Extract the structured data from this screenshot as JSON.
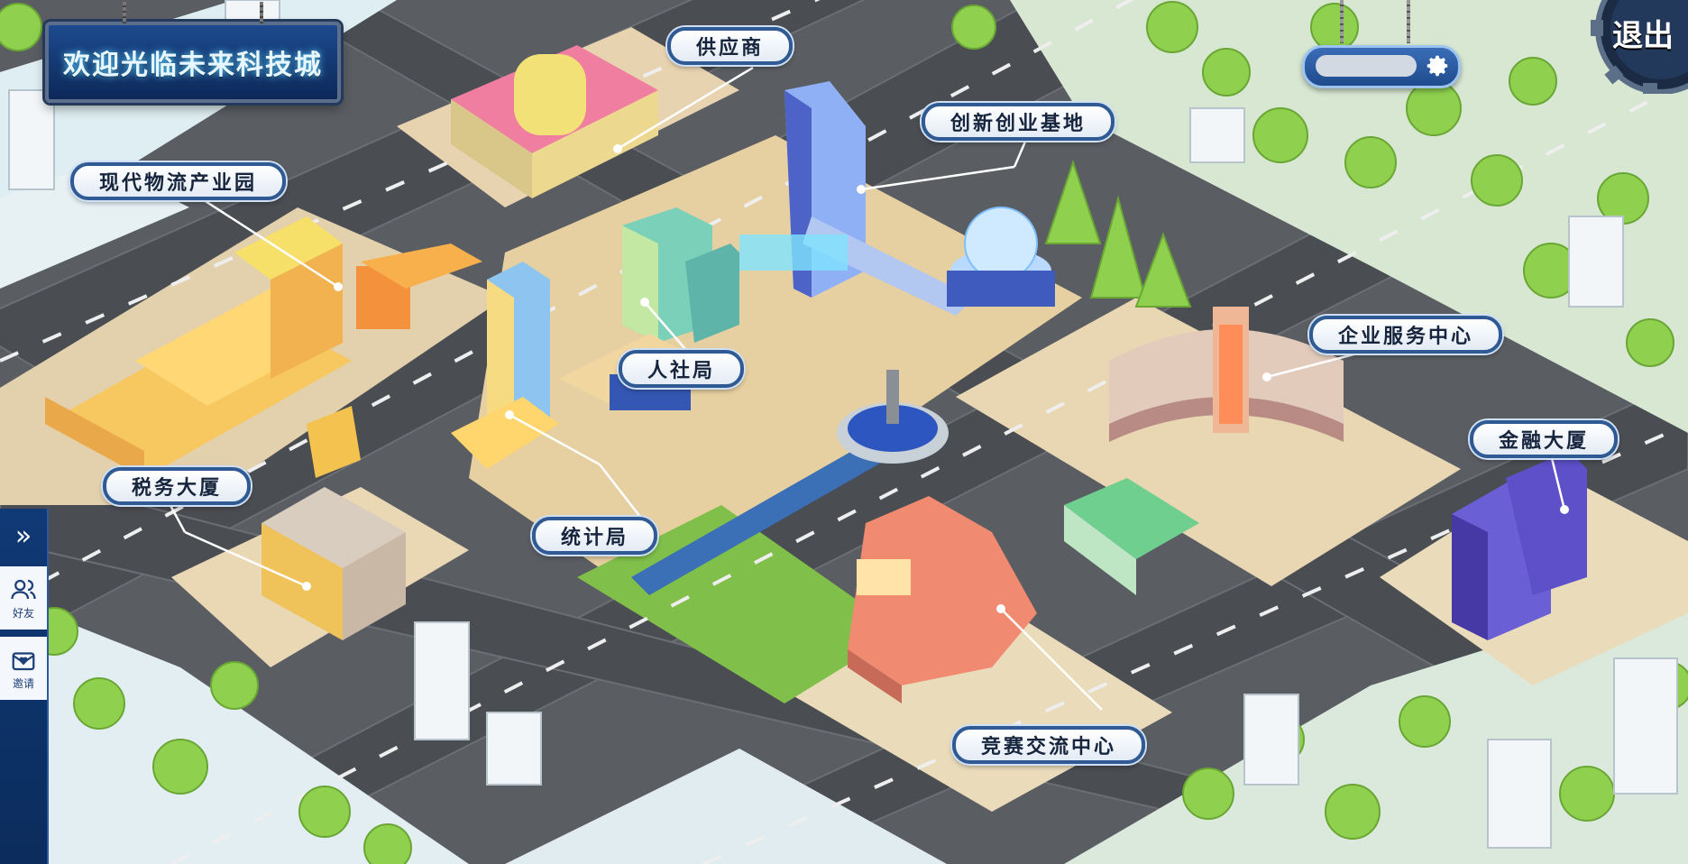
{
  "title": "欢迎光临未来科技城",
  "exit_label": "退出",
  "user": {
    "name": "",
    "settings_icon": "gear-icon"
  },
  "sidebar": {
    "expand_icon": "double-chevron-right-icon",
    "items": [
      {
        "label": "好友",
        "icon": "friends-icon"
      },
      {
        "label": "邀请",
        "icon": "invite-icon"
      }
    ]
  },
  "buildings": [
    {
      "id": "supplier",
      "label": "供应商"
    },
    {
      "id": "innovation-base",
      "label": "创新创业基地"
    },
    {
      "id": "logistics-park",
      "label": "现代物流产业园"
    },
    {
      "id": "hr-bureau",
      "label": "人社局"
    },
    {
      "id": "enterprise-service",
      "label": "企业服务中心"
    },
    {
      "id": "finance-tower",
      "label": "金融大厦"
    },
    {
      "id": "tax-building",
      "label": "税务大厦"
    },
    {
      "id": "statistics-bureau",
      "label": "统计局"
    },
    {
      "id": "competition-center",
      "label": "竞赛交流中心"
    }
  ],
  "colors": {
    "accent": "#2f5a94",
    "banner": "#1c4a8e",
    "road": "#4a4d52",
    "grass": "#8fd14f",
    "plaza": "#e6cfa0"
  }
}
